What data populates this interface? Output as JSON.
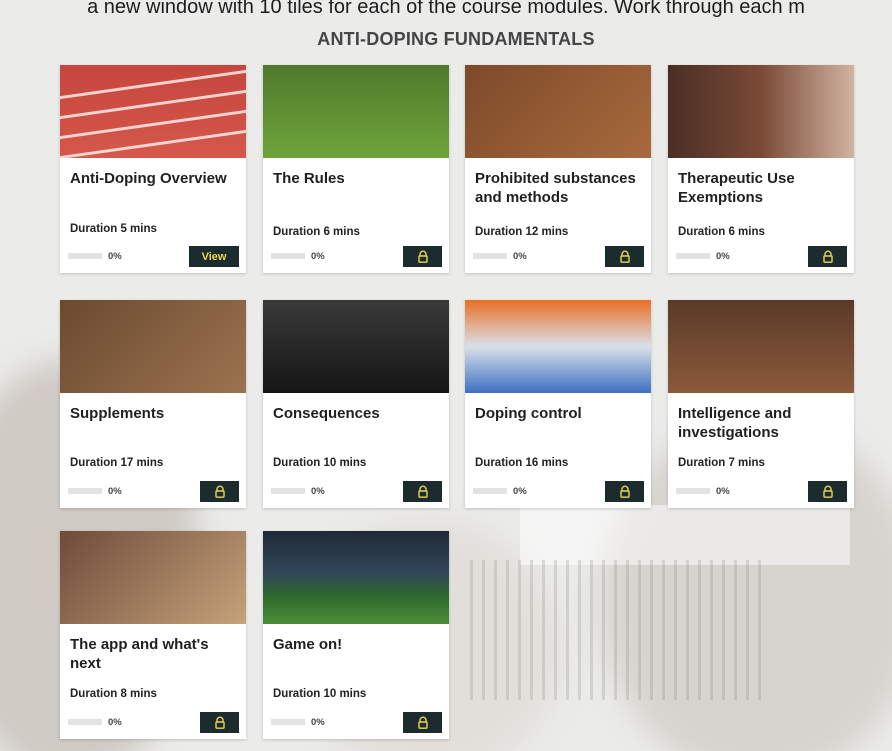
{
  "caption": "a new window with 10 tiles for each of the course modules. Work through each m",
  "page_title": "ANTI-DOPING FUNDAMENTALS",
  "modules": [
    {
      "title": "Anti-Doping Overview",
      "duration": "Duration 5 mins",
      "progress": "0%",
      "action": "View",
      "locked": false,
      "art": "art-track"
    },
    {
      "title": "The Rules",
      "duration": "Duration 6 mins",
      "progress": "0%",
      "action": "",
      "locked": true,
      "art": "art-rules"
    },
    {
      "title": "Prohibited substances and methods",
      "duration": "Duration 12 mins",
      "progress": "0%",
      "action": "",
      "locked": true,
      "art": "art-pills"
    },
    {
      "title": "Therapeutic Use Exemptions",
      "duration": "Duration 6 mins",
      "progress": "0%",
      "action": "",
      "locked": true,
      "art": "art-inhaler"
    },
    {
      "title": "Supplements",
      "duration": "Duration 17 mins",
      "progress": "0%",
      "action": "",
      "locked": true,
      "art": "art-supp"
    },
    {
      "title": "Consequences",
      "duration": "Duration 10 mins",
      "progress": "0%",
      "action": "",
      "locked": true,
      "art": "art-conseq"
    },
    {
      "title": "Doping control",
      "duration": "Duration 16 mins",
      "progress": "0%",
      "action": "",
      "locked": true,
      "art": "art-doping"
    },
    {
      "title": "Intelligence and investigations",
      "duration": "Duration 7 mins",
      "progress": "0%",
      "action": "",
      "locked": true,
      "art": "art-intel"
    },
    {
      "title": "The app and what's next",
      "duration": "Duration 8 mins",
      "progress": "0%",
      "action": "",
      "locked": true,
      "art": "art-app"
    },
    {
      "title": "Game on!",
      "duration": "Duration 10 mins",
      "progress": "0%",
      "action": "",
      "locked": true,
      "art": "art-game"
    }
  ],
  "colors": {
    "button_bg": "#1c2b2d",
    "button_text": "#e7d84f",
    "title_text": "#454545"
  }
}
